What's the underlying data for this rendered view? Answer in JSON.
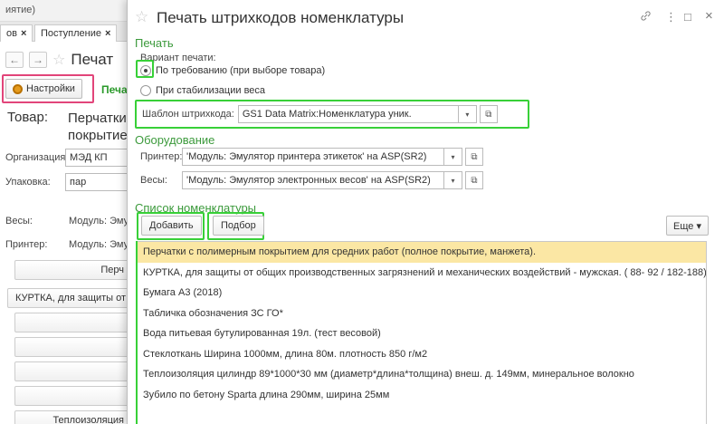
{
  "background": {
    "top_fragment": "иятие)",
    "tabs": [
      {
        "label": "ов"
      },
      {
        "label": "Поступление"
      }
    ],
    "tab_close": "×",
    "title_fragment": "Печат",
    "settings_button": "Настройки",
    "print_label_fragment": "Печа",
    "goods_label": "Товар:",
    "goods_value_fragment": "Перчатки покрытие",
    "organization_label": "Организация:",
    "organization_value": "МЭД КП",
    "package_label": "Упаковка:",
    "package_value": "пар",
    "scales_label": "Весы:",
    "scales_value": "Модуль: Эму",
    "printer_label": "Принтер:",
    "printer_value": "Модуль: Эму",
    "buttons": [
      "Перч",
      "КУРТКА, для защиты от",
      "",
      "",
      "",
      "",
      ""
    ],
    "bottom_fragment": "Теплоизоляция"
  },
  "dialog": {
    "title": "Печать штрихкодов номенклатуры",
    "print_section": "Печать",
    "print_option_label": "Вариант печати:",
    "radio_options": [
      {
        "label": "По требованию (при выборе товара)",
        "selected": true
      },
      {
        "label": "При стабилизации веса",
        "selected": false
      }
    ],
    "template_label": "Шаблон штрихкода:",
    "template_value": "GS1 Data Matrix:Номенклатура уник.",
    "equipment_section": "Оборудование",
    "printer_label": "Принтер:",
    "printer_value": "'Модуль: Эмулятор принтера этикеток' на ASP(SR2)",
    "scales_label": "Весы:",
    "scales_value": "'Модуль: Эмулятор электронных весов' на ASP(SR2)",
    "list_section": "Список номенклатуры",
    "add_button": "Добавить",
    "pick_button": "Подбор",
    "more_button": "Еще",
    "items": [
      "Перчатки с полимерным покрытием для средних работ (полное покрытие, манжета).",
      "КУРТКА, для защиты от общих производственных загрязнений и механических воздействий - мужская. ( 88- 92 / 182-188)",
      "Бумага А3 (2018)",
      "Табличка обозначения ЗС ГО*",
      "Вода питьевая бутулированная 19л. (тест весовой)",
      "Стеклоткань Ширина 1000мм, длина 80м. плотность 850 г/м2",
      "Теплоизоляция цилиндр  89*1000*30 мм (диаметр*длина*толщина) внеш. д. 149мм, минеральное волокно",
      "Зубило по бетону Sparta длина 290мм, ширина 25мм"
    ],
    "selected_index": 0
  },
  "icons": {
    "star": "☆",
    "link": "🔗",
    "menu": "⋮",
    "minimize": "□",
    "close": "×",
    "dropdown": "▾",
    "open": "⧉",
    "back": "←",
    "forward": "→"
  },
  "colors": {
    "section_green": "#3c9a3c",
    "highlight_green": "#38d038",
    "highlight_pink": "#e2457a",
    "selected_row": "#fbe7a4"
  }
}
